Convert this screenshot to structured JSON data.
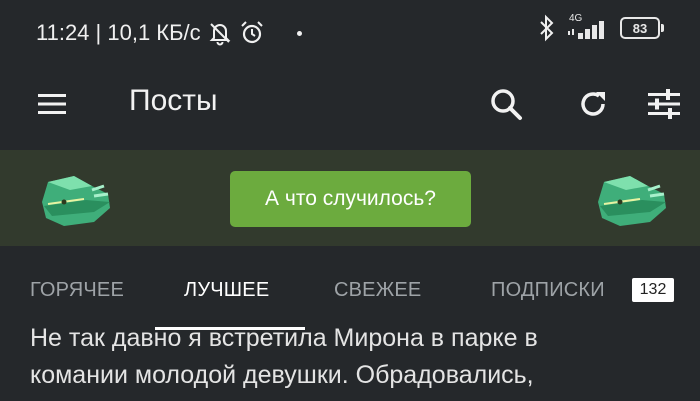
{
  "status_bar": {
    "time_speed": "11:24 | 10,1 КБ/с",
    "battery": "83",
    "network": "4G",
    "icons": [
      "muted-bell-icon",
      "alarm-icon",
      "dot-icon",
      "bluetooth-icon",
      "signal-icon",
      "battery-icon"
    ]
  },
  "topbar": {
    "title": "Посты",
    "icons": [
      "menu-icon",
      "search-icon",
      "refresh-icon",
      "filter-icon"
    ]
  },
  "banner": {
    "button_label": "А что случилось?",
    "colors": {
      "background": "#323a2d",
      "button": "#6cab3e"
    }
  },
  "tabs": {
    "items": [
      "ГОРЯЧЕЕ",
      "ЛУЧШЕЕ",
      "СВЕЖЕЕ",
      "ПОДПИСКИ"
    ],
    "active": "ЛУЧШЕЕ",
    "subscriptions_count": "132"
  },
  "content": {
    "line1": "Не так давно я встретила Мирона в парке в",
    "line2": "комании молодой девушки. Обрадовались,"
  }
}
